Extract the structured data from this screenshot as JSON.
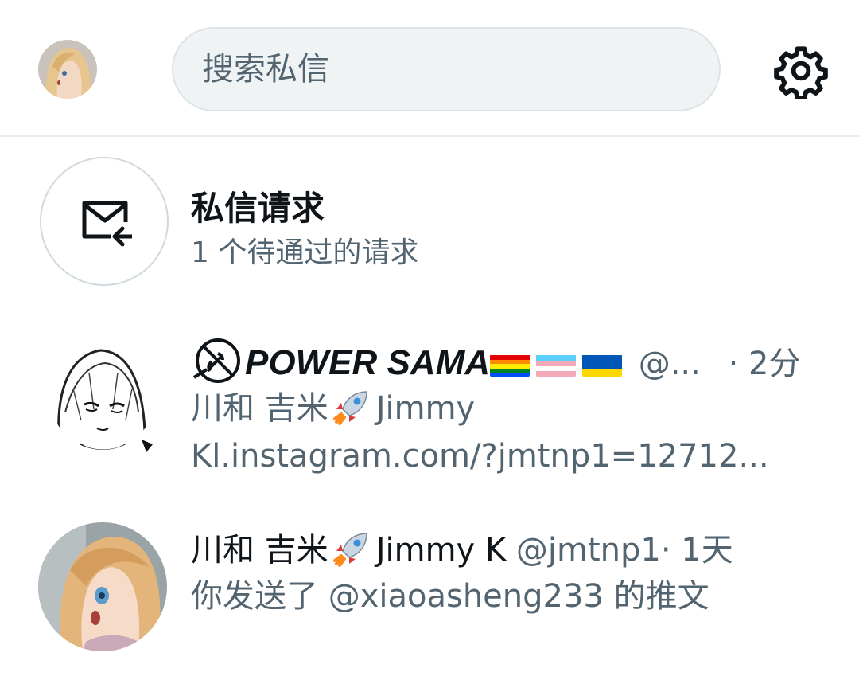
{
  "search": {
    "placeholder": "搜索私信"
  },
  "icons": {
    "settings": "gear-icon",
    "requests": "mail-incoming-icon",
    "rocket": "rocket-emoji"
  },
  "requests": {
    "title": "私信请求",
    "subtitle": "1 个待通过的请求"
  },
  "conversations": [
    {
      "display_name": "POWER SAMA",
      "handle": "@...",
      "time": "· 2分",
      "flags": [
        "rainbow",
        "trans",
        "ukraine"
      ],
      "preview_line1_name": "川和 吉米",
      "preview_line1_rest": "Jimmy",
      "preview_line2": "Kl.instagram.com/?jmtnp1=12712..."
    },
    {
      "name_cn": "川和 吉米",
      "name_en": "Jimmy K",
      "handle": "@jmtnp1",
      "time": "· 1天",
      "preview": "你发送了 @xiaoasheng233 的推文"
    }
  ],
  "colors": {
    "text": "#0f1419",
    "secondary": "#536471",
    "search_bg": "#eff3f4",
    "divider": "#e6ecf0"
  }
}
